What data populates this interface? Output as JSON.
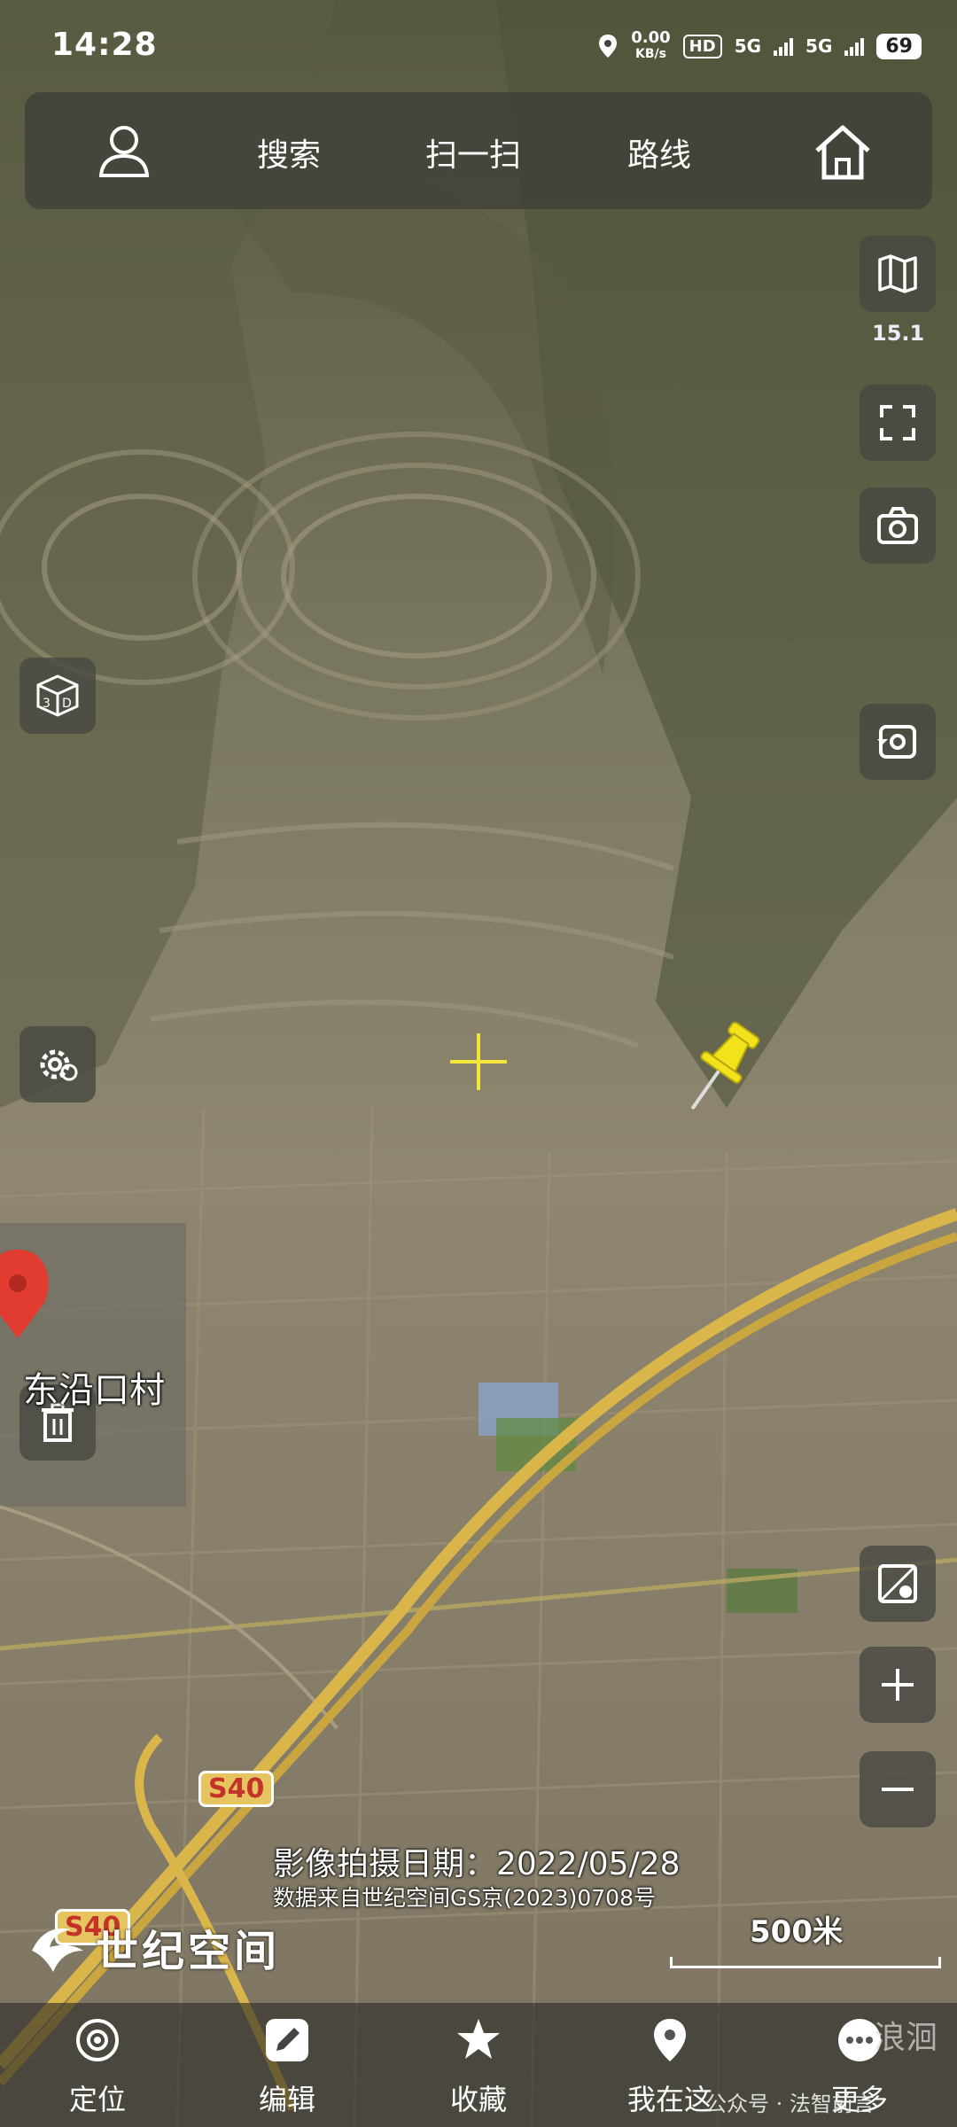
{
  "status_bar": {
    "time": "14:28",
    "net_speed_value": "0.00",
    "net_speed_unit": "KB/s",
    "hd_label": "HD",
    "sim1": "5G",
    "sim2": "5G",
    "battery": "69"
  },
  "top_bar": {
    "search_label": "搜索",
    "scan_label": "扫一扫",
    "route_label": "路线"
  },
  "side": {
    "zoom_level": "15.1"
  },
  "map": {
    "village_label": "东沿口村",
    "road_label": "S40",
    "capture_date": "影像拍摄日期：2022/05/28",
    "data_source": "数据来自世纪空间GS京(2023)0708号",
    "brand_name": "世纪空间",
    "scale_label": "500米"
  },
  "bottom_bar": {
    "tabs": [
      {
        "label": "定位"
      },
      {
        "label": "编辑"
      },
      {
        "label": "收藏"
      },
      {
        "label": "我在这"
      },
      {
        "label": "更多"
      }
    ]
  },
  "watermark": "公众号 · 法智前言",
  "watermark_2": "浪洄",
  "colors": {
    "pin_yellow": "#f2e21c",
    "pin_red": "#e23b2f",
    "highway": "#d9b54a",
    "crosshair": "#f3e53a"
  }
}
